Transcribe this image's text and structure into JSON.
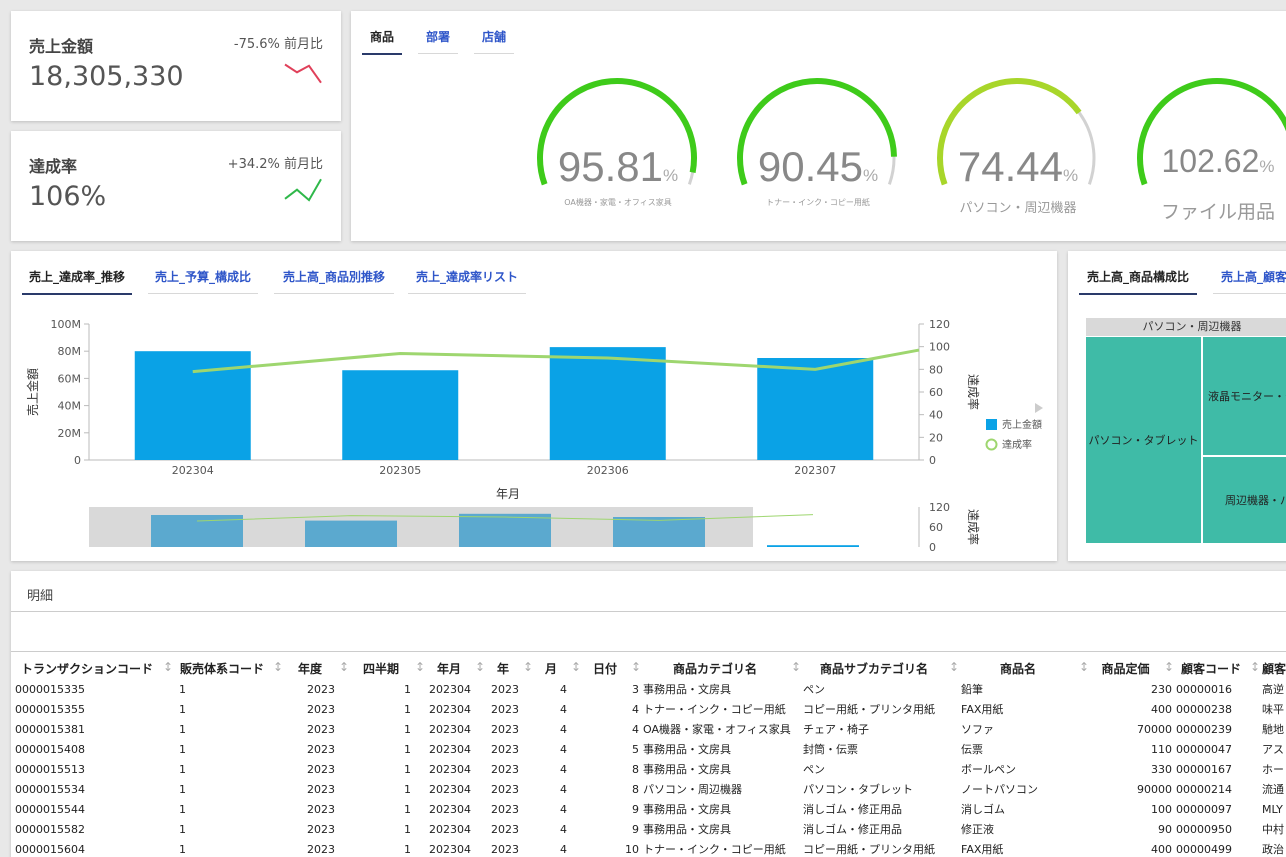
{
  "kpis": [
    {
      "title": "売上金額",
      "change": "-75.6% 前月比",
      "value": "18,305,330",
      "trend_color": "#e0405a",
      "spark": [
        0.25,
        0.55,
        0.3,
        0.95
      ]
    },
    {
      "title": "達成率",
      "change": "+34.2% 前月比",
      "value": "106%",
      "trend_color": "#2fb84a",
      "spark": [
        0.8,
        0.45,
        0.85,
        0.05
      ]
    }
  ],
  "gauge_tabs": [
    "商品",
    "部署",
    "店舗"
  ],
  "gauges": [
    {
      "value": "95.81",
      "unit": "%",
      "label": "OA機器・家電・オフィス家具",
      "fraction": 0.9581,
      "color": "#3ecb1a"
    },
    {
      "value": "90.45",
      "unit": "%",
      "label": "トナー・インク・コピー用紙",
      "fraction": 0.9045,
      "color": "#3ecb1a"
    },
    {
      "value": "74.44",
      "unit": "%",
      "label": "パソコン・周辺機器",
      "fraction": 0.7444,
      "color": "#a8d62a"
    },
    {
      "value": "102.62",
      "unit": "%",
      "label": "ファイル用品",
      "fraction": 1.0,
      "color": "#3ecb1a"
    }
  ],
  "chart_tabs": [
    "売上_達成率_推移",
    "売上_予算_構成比",
    "売上高_商品別推移",
    "売上_達成率リスト"
  ],
  "treemap_tabs": [
    "売上高_商品構成比",
    "売上高_顧客"
  ],
  "chart_data": {
    "type": "bar",
    "categories": [
      "202304",
      "202305",
      "202306",
      "202307"
    ],
    "series": [
      {
        "name": "売上金額",
        "values": [
          80000000,
          66000000,
          83000000,
          75000000
        ],
        "color": "#0aa2e6"
      },
      {
        "name": "達成率",
        "values": [
          78,
          94,
          90,
          80
        ],
        "color": "#9ed66f"
      }
    ],
    "overview": {
      "extra_bar": 4500000,
      "extra_rate": 97
    },
    "xlabel": "年月",
    "ylabel": "売上金額",
    "y2label": "達成率",
    "ylim": [
      0,
      100000000
    ],
    "y2lim": [
      0,
      120
    ],
    "yticks": [
      "100M",
      "80M",
      "60M",
      "40M",
      "20M",
      "0"
    ],
    "y2ticks": [
      "120",
      "100",
      "80",
      "60",
      "40",
      "20",
      "0"
    ],
    "overview_y2ticks": [
      "120",
      "60",
      "0"
    ],
    "legend_position": "right"
  },
  "treemap": {
    "header": "パソコン・周辺機器",
    "cells": [
      "パソコン・タブレット",
      "液晶モニター・デ",
      "周辺機器・パ"
    ]
  },
  "detail": {
    "title": "明細",
    "columns": [
      "トランザクションコード",
      "販売体系コード",
      "年度",
      "四半期",
      "年月",
      "年",
      "月",
      "日付",
      "商品カテゴリ名",
      "商品サブカテゴリ名",
      "商品名",
      "商品定価",
      "顧客コード",
      "顧客"
    ],
    "rows": [
      [
        "0000015335",
        "1",
        "2023",
        "1",
        "202304",
        "2023",
        "4",
        "3",
        "事務用品・文房具",
        "ペン",
        "鉛筆",
        "230",
        "00000016",
        "高逆"
      ],
      [
        "0000015355",
        "1",
        "2023",
        "1",
        "202304",
        "2023",
        "4",
        "4",
        "トナー・インク・コピー用紙",
        "コピー用紙・プリンタ用紙",
        "FAX用紙",
        "400",
        "00000238",
        "味平"
      ],
      [
        "0000015381",
        "1",
        "2023",
        "1",
        "202304",
        "2023",
        "4",
        "4",
        "OA機器・家電・オフィス家具",
        "チェア・椅子",
        "ソファ",
        "70000",
        "00000239",
        "馳地"
      ],
      [
        "0000015408",
        "1",
        "2023",
        "1",
        "202304",
        "2023",
        "4",
        "5",
        "事務用品・文房具",
        "封筒・伝票",
        "伝票",
        "110",
        "00000047",
        "アス"
      ],
      [
        "0000015513",
        "1",
        "2023",
        "1",
        "202304",
        "2023",
        "4",
        "8",
        "事務用品・文房具",
        "ペン",
        "ボールペン",
        "330",
        "00000167",
        "ホー"
      ],
      [
        "0000015534",
        "1",
        "2023",
        "1",
        "202304",
        "2023",
        "4",
        "8",
        "パソコン・周辺機器",
        "パソコン・タブレット",
        "ノートパソコン",
        "90000",
        "00000214",
        "流通"
      ],
      [
        "0000015544",
        "1",
        "2023",
        "1",
        "202304",
        "2023",
        "4",
        "9",
        "事務用品・文房具",
        "消しゴム・修正用品",
        "消しゴム",
        "100",
        "00000097",
        "MLY"
      ],
      [
        "0000015582",
        "1",
        "2023",
        "1",
        "202304",
        "2023",
        "4",
        "9",
        "事務用品・文房具",
        "消しゴム・修正用品",
        "修正液",
        "90",
        "00000950",
        "中村"
      ],
      [
        "0000015604",
        "1",
        "2023",
        "1",
        "202304",
        "2023",
        "4",
        "10",
        "トナー・インク・コピー用紙",
        "コピー用紙・プリンタ用紙",
        "FAX用紙",
        "400",
        "00000499",
        "政治"
      ]
    ]
  }
}
